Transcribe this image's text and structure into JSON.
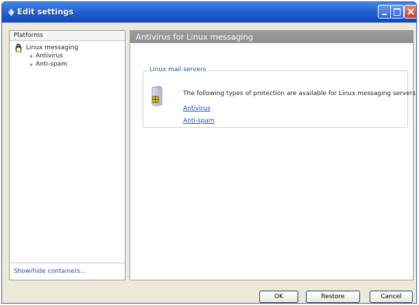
{
  "window": {
    "title": "Edit settings",
    "controls": [
      "minimize-icon",
      "maximize-icon",
      "close-icon"
    ]
  },
  "left_panel": {
    "header": "Platforms",
    "tree": {
      "root": {
        "label": "Linux messaging",
        "icon": "penguin-icon"
      },
      "children": [
        {
          "label": "Antivirus"
        },
        {
          "label": "Anti-spam"
        }
      ]
    },
    "footer_link": "Show/hide containers..."
  },
  "right_panel": {
    "header": "Antivirus for Linux messaging",
    "group": {
      "legend": "Linux mail servers",
      "icon": "server-icon",
      "description": "The following types of protection are available for Linux messaging servers:",
      "links": [
        "Antivirus",
        "Anti-spam"
      ]
    }
  },
  "buttons": {
    "ok": "OK",
    "restore": "Restore",
    "cancel": "Cancel"
  },
  "colors": {
    "titlebar": "#2563d3",
    "panel_header": "#959595",
    "link": "#1d4ea3"
  }
}
